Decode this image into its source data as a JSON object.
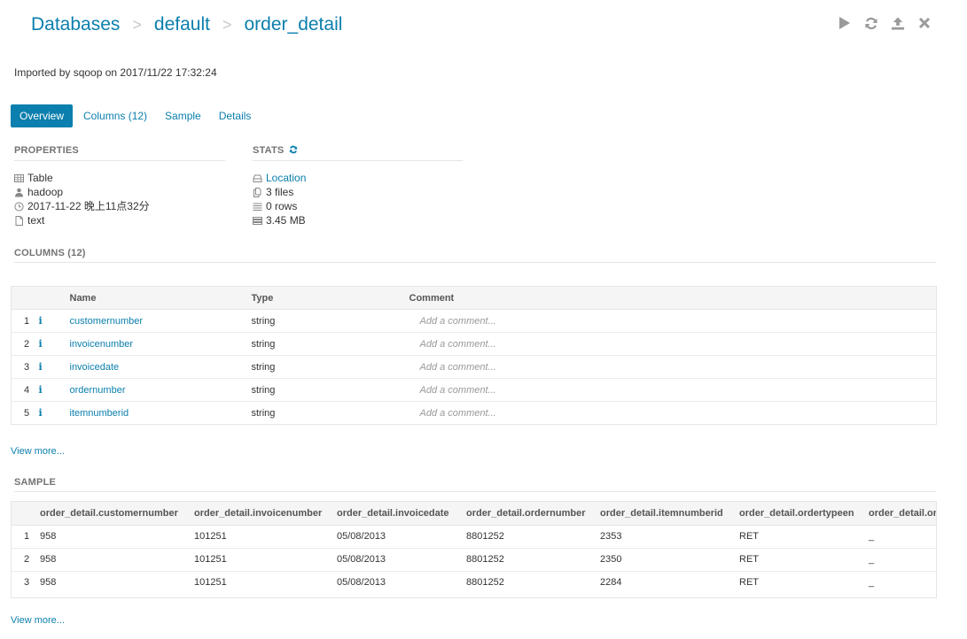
{
  "breadcrumb": [
    "Databases",
    "default",
    "order_detail"
  ],
  "breadcrumb_separator": ">",
  "toolbar": {
    "icons": [
      "play-icon",
      "refresh-icon",
      "upload-icon",
      "close-icon"
    ]
  },
  "imported_text": "Imported by sqoop on 2017/11/22 17:32:24",
  "tabs": [
    {
      "label": "Overview",
      "active": true
    },
    {
      "label": "Columns (12)",
      "active": false
    },
    {
      "label": "Sample",
      "active": false
    },
    {
      "label": "Details",
      "active": false
    }
  ],
  "properties": {
    "title": "PROPERTIES",
    "items": [
      {
        "icon": "table-icon",
        "text": "Table"
      },
      {
        "icon": "user-icon",
        "text": "hadoop"
      },
      {
        "icon": "clock-icon",
        "text": "2017-11-22 晚上11点32分"
      },
      {
        "icon": "file-icon",
        "text": "text"
      }
    ]
  },
  "stats": {
    "title": "STATS",
    "items": [
      {
        "icon": "hdd-icon",
        "text": "Location",
        "link": true
      },
      {
        "icon": "files-icon",
        "text": "3 files",
        "link": false
      },
      {
        "icon": "list-icon",
        "text": "0 rows",
        "link": false
      },
      {
        "icon": "tasks-icon",
        "text": "3.45 MB",
        "link": false
      }
    ]
  },
  "columns_section": {
    "title": "COLUMNS (12)",
    "headers": [
      "Name",
      "Type",
      "Comment"
    ],
    "rows": [
      {
        "n": "1",
        "name": "customernumber",
        "type": "string",
        "comment": "Add a comment..."
      },
      {
        "n": "2",
        "name": "invoicenumber",
        "type": "string",
        "comment": "Add a comment..."
      },
      {
        "n": "3",
        "name": "invoicedate",
        "type": "string",
        "comment": "Add a comment..."
      },
      {
        "n": "4",
        "name": "ordernumber",
        "type": "string",
        "comment": "Add a comment..."
      },
      {
        "n": "5",
        "name": "itemnumberid",
        "type": "string",
        "comment": "Add a comment..."
      }
    ],
    "view_more": "View more..."
  },
  "sample_section": {
    "title": "SAMPLE",
    "headers": [
      "order_detail.customernumber",
      "order_detail.invoicenumber",
      "order_detail.invoicedate",
      "order_detail.ordernumber",
      "order_detail.itemnumberid",
      "order_detail.ordertypeen",
      "order_detail.or"
    ],
    "rows": [
      {
        "n": "1",
        "cells": [
          "958",
          "101251",
          "05/08/2013",
          "8801252",
          "2353",
          "RET",
          "_"
        ]
      },
      {
        "n": "2",
        "cells": [
          "958",
          "101251",
          "05/08/2013",
          "8801252",
          "2350",
          "RET",
          "_"
        ]
      },
      {
        "n": "3",
        "cells": [
          "958",
          "101251",
          "05/08/2013",
          "8801252",
          "2284",
          "RET",
          "_"
        ]
      }
    ],
    "view_more": "View more..."
  }
}
